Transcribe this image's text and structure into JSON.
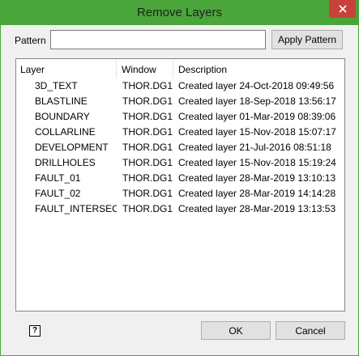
{
  "window": {
    "title": "Remove Layers"
  },
  "pattern": {
    "label": "Pattern",
    "value": ""
  },
  "buttons": {
    "apply_pattern": "Apply Pattern",
    "ok": "OK",
    "cancel": "Cancel"
  },
  "table": {
    "columns": [
      "Layer",
      "Window",
      "Description"
    ],
    "rows": [
      {
        "layer": "3D_TEXT",
        "window": "THOR.DG1",
        "description": "Created layer 24-Oct-2018 09:49:56"
      },
      {
        "layer": "BLASTLINE",
        "window": "THOR.DG1",
        "description": "Created layer 18-Sep-2018 13:56:17"
      },
      {
        "layer": "BOUNDARY",
        "window": "THOR.DG1",
        "description": "Created layer 01-Mar-2019 08:39:06"
      },
      {
        "layer": "COLLARLINE",
        "window": "THOR.DG1",
        "description": "Created layer 15-Nov-2018 15:07:17"
      },
      {
        "layer": "DEVELOPMENT",
        "window": "THOR.DG1",
        "description": "Created layer 21-Jul-2016 08:51:18"
      },
      {
        "layer": "DRILLHOLES",
        "window": "THOR.DG1",
        "description": "Created layer 15-Nov-2018 15:19:24"
      },
      {
        "layer": "FAULT_01",
        "window": "THOR.DG1",
        "description": "Created layer 28-Mar-2019 13:10:13"
      },
      {
        "layer": "FAULT_02",
        "window": "THOR.DG1",
        "description": "Created layer 28-Mar-2019 14:14:28"
      },
      {
        "layer": "FAULT_INTERSECT",
        "window": "THOR.DG1",
        "description": "Created layer 28-Mar-2019 13:13:53"
      }
    ]
  },
  "icons": {
    "close": "close-icon",
    "help": "help-icon"
  },
  "colors": {
    "titlebar": "#4aa63a",
    "close_button": "#c7433a"
  }
}
